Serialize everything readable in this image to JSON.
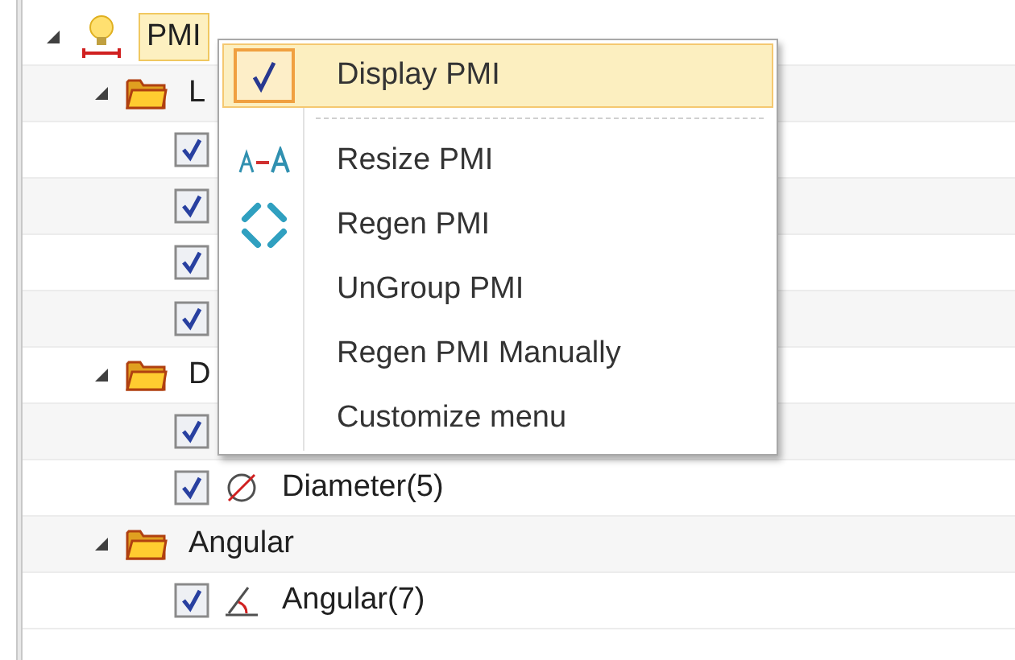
{
  "tree": [
    {
      "label": "PMI",
      "kind": "pmi",
      "expanded": true,
      "selected": true,
      "children": [
        {
          "label": "L",
          "kind": "folder",
          "expanded": true,
          "children": [
            {
              "kind": "item",
              "checked": true
            },
            {
              "kind": "item",
              "checked": true
            },
            {
              "kind": "item",
              "checked": true
            },
            {
              "kind": "item",
              "checked": true
            }
          ]
        },
        {
          "label": "D",
          "kind": "folder",
          "expanded": true,
          "children": [
            {
              "kind": "item",
              "checked": true
            },
            {
              "kind": "diameter",
              "label": "Diameter(5)",
              "checked": true
            }
          ]
        },
        {
          "label": "Angular",
          "kind": "folder",
          "expanded": true,
          "children": [
            {
              "kind": "angle",
              "label": "Angular(7)",
              "checked": true
            }
          ]
        }
      ]
    }
  ],
  "context_menu": {
    "items": [
      {
        "kind": "check",
        "label": "Display PMI",
        "checked": true,
        "selected": true
      },
      {
        "kind": "separator"
      },
      {
        "kind": "resize",
        "label": "Resize PMI",
        "selected": false
      },
      {
        "kind": "regen",
        "label": "Regen PMI",
        "selected": false
      },
      {
        "kind": "plain",
        "label": "UnGroup PMI",
        "selected": false
      },
      {
        "kind": "plain",
        "label": "Regen PMI Manually",
        "selected": false
      },
      {
        "kind": "plain",
        "label": "Customize menu",
        "selected": false
      }
    ]
  }
}
